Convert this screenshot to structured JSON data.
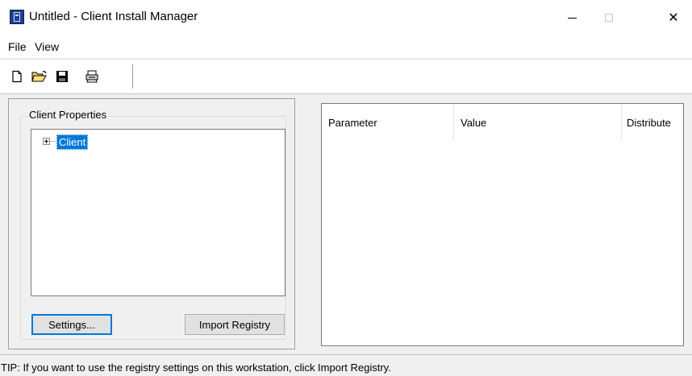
{
  "window": {
    "title": "Untitled - Client Install Manager",
    "controls": [
      "minimize-icon",
      "maximize-icon",
      "close-icon"
    ],
    "close_glyph": "✕"
  },
  "menu": {
    "file": "File",
    "view": "View"
  },
  "toolbar": {
    "icons": [
      "new-file-icon",
      "open-folder-icon",
      "save-icon",
      "print-icon"
    ]
  },
  "client_properties": {
    "group_label": "Client Properties",
    "tree": {
      "root_label": "Client",
      "expanded": false,
      "selected": true
    },
    "settings_button": "Settings...",
    "import_button": "Import Registry"
  },
  "list_view": {
    "columns": [
      "Parameter",
      "Value",
      "Distribute"
    ],
    "rows": []
  },
  "status_bar": {
    "tip": "TIP: If you want to use the registry settings on this workstation, click Import Registry."
  },
  "colors": {
    "selection": "#0078d7",
    "window_bg": "#f0f0f0",
    "accent_border": "#0078d7"
  }
}
